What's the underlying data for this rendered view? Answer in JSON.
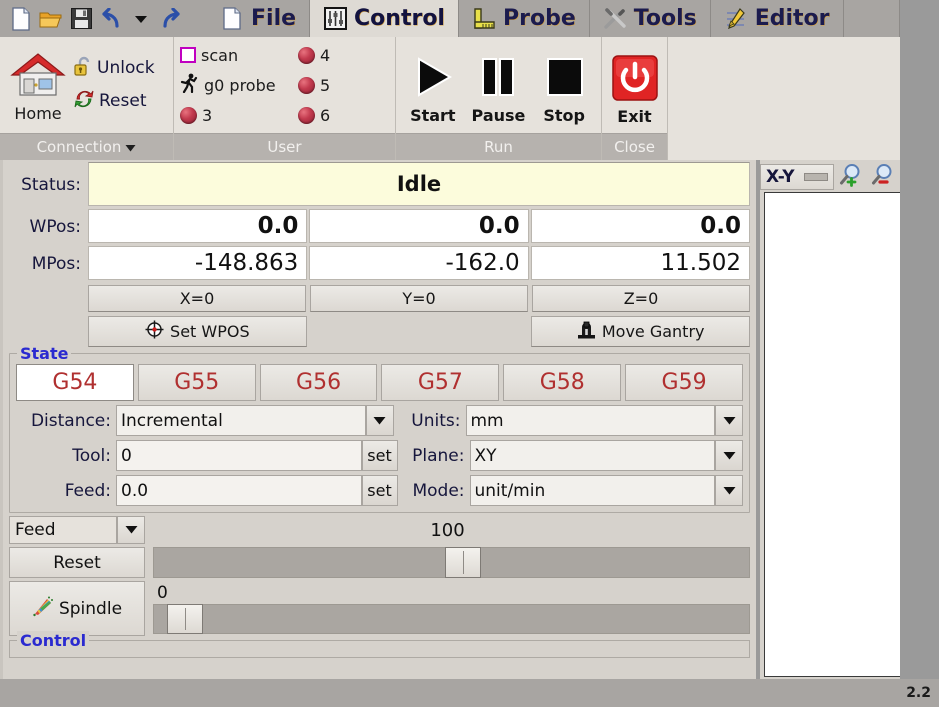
{
  "menubar": {
    "quick_icons": [
      {
        "name": "new-file-icon",
        "label": "New"
      },
      {
        "name": "open-folder-icon",
        "label": "Open"
      },
      {
        "name": "save-icon",
        "label": "Save"
      },
      {
        "name": "undo-icon",
        "label": "Undo"
      },
      {
        "name": "undo-dropdown-icon",
        "label": "Undo history"
      },
      {
        "name": "redo-icon",
        "label": "Redo"
      }
    ],
    "tabs": [
      {
        "label": "File",
        "icon": "file-page-icon",
        "active": false
      },
      {
        "label": "Control",
        "icon": "sliders-icon",
        "active": true
      },
      {
        "label": "Probe",
        "icon": "ruler-icon",
        "active": false
      },
      {
        "label": "Tools",
        "icon": "wrench-screwdriver-icon",
        "active": false
      },
      {
        "label": "Editor",
        "icon": "pencil-icon",
        "active": false
      }
    ]
  },
  "ribbon": {
    "connection": {
      "group_label": "Connection",
      "home_label": "Home",
      "unlock_label": "Unlock",
      "reset_label": "Reset"
    },
    "user": {
      "group_label": "User",
      "buttons": [
        {
          "label": "scan",
          "icon": "square-outline-icon"
        },
        {
          "label": "4",
          "icon": "led-icon"
        },
        {
          "label": "g0 probe",
          "icon": "runner-icon"
        },
        {
          "label": "5",
          "icon": "led-icon"
        },
        {
          "label": "3",
          "icon": "led-icon"
        },
        {
          "label": "6",
          "icon": "led-icon"
        }
      ]
    },
    "run": {
      "group_label": "Run",
      "buttons": [
        {
          "label": "Start",
          "icon": "play-icon"
        },
        {
          "label": "Pause",
          "icon": "pause-icon"
        },
        {
          "label": "Stop",
          "icon": "stop-icon"
        }
      ]
    },
    "close": {
      "group_label": "Close",
      "exit_label": "Exit",
      "exit_icon": "power-icon"
    }
  },
  "dro": {
    "status_label": "Status:",
    "status_value": "Idle",
    "wpos_label": "WPos:",
    "wpos": [
      "0.0",
      "0.0",
      "0.0"
    ],
    "mpos_label": "MPos:",
    "mpos": [
      "-148.863",
      "-162.0",
      "11.502"
    ],
    "zero_buttons": [
      "X=0",
      "Y=0",
      "Z=0"
    ],
    "set_wpos_label": "Set WPOS",
    "set_wpos_icon": "crosshair-icon",
    "move_gantry_label": "Move Gantry",
    "move_gantry_icon": "gantry-icon"
  },
  "state": {
    "group_label": "State",
    "wcs": [
      {
        "label": "G54",
        "selected": true
      },
      {
        "label": "G55",
        "selected": false
      },
      {
        "label": "G56",
        "selected": false
      },
      {
        "label": "G57",
        "selected": false
      },
      {
        "label": "G58",
        "selected": false
      },
      {
        "label": "G59",
        "selected": false
      }
    ],
    "distance_label": "Distance:",
    "distance_value": "Incremental",
    "units_label": "Units:",
    "units_value": "mm",
    "tool_label": "Tool:",
    "tool_value": "0",
    "tool_set_label": "set",
    "plane_label": "Plane:",
    "plane_value": "XY",
    "feed_label": "Feed:",
    "feed_value": "0.0",
    "feed_set_label": "set",
    "mode_label": "Mode:",
    "mode_value": "unit/min"
  },
  "override": {
    "selector_value": "Feed",
    "value": "100",
    "reset_label": "Reset",
    "spindle_label": "Spindle",
    "spindle_icon": "spindle-icon",
    "spindle_value": "0",
    "feed_slider_percent": 52,
    "spindle_slider_percent": 2
  },
  "control_group": {
    "group_label": "Control"
  },
  "viewer": {
    "view_value": "X-Y",
    "zoom_in_icon": "zoom-in-icon",
    "zoom_out_icon": "zoom-out-icon"
  },
  "statusbar": {
    "version": "2.2"
  },
  "colors": {
    "accent_blue": "#2a2ad0",
    "wcs_red": "#b03030",
    "status_bg": "#fcfcdc",
    "led_red": "#c23a4e",
    "exit_red": "#e02020"
  }
}
